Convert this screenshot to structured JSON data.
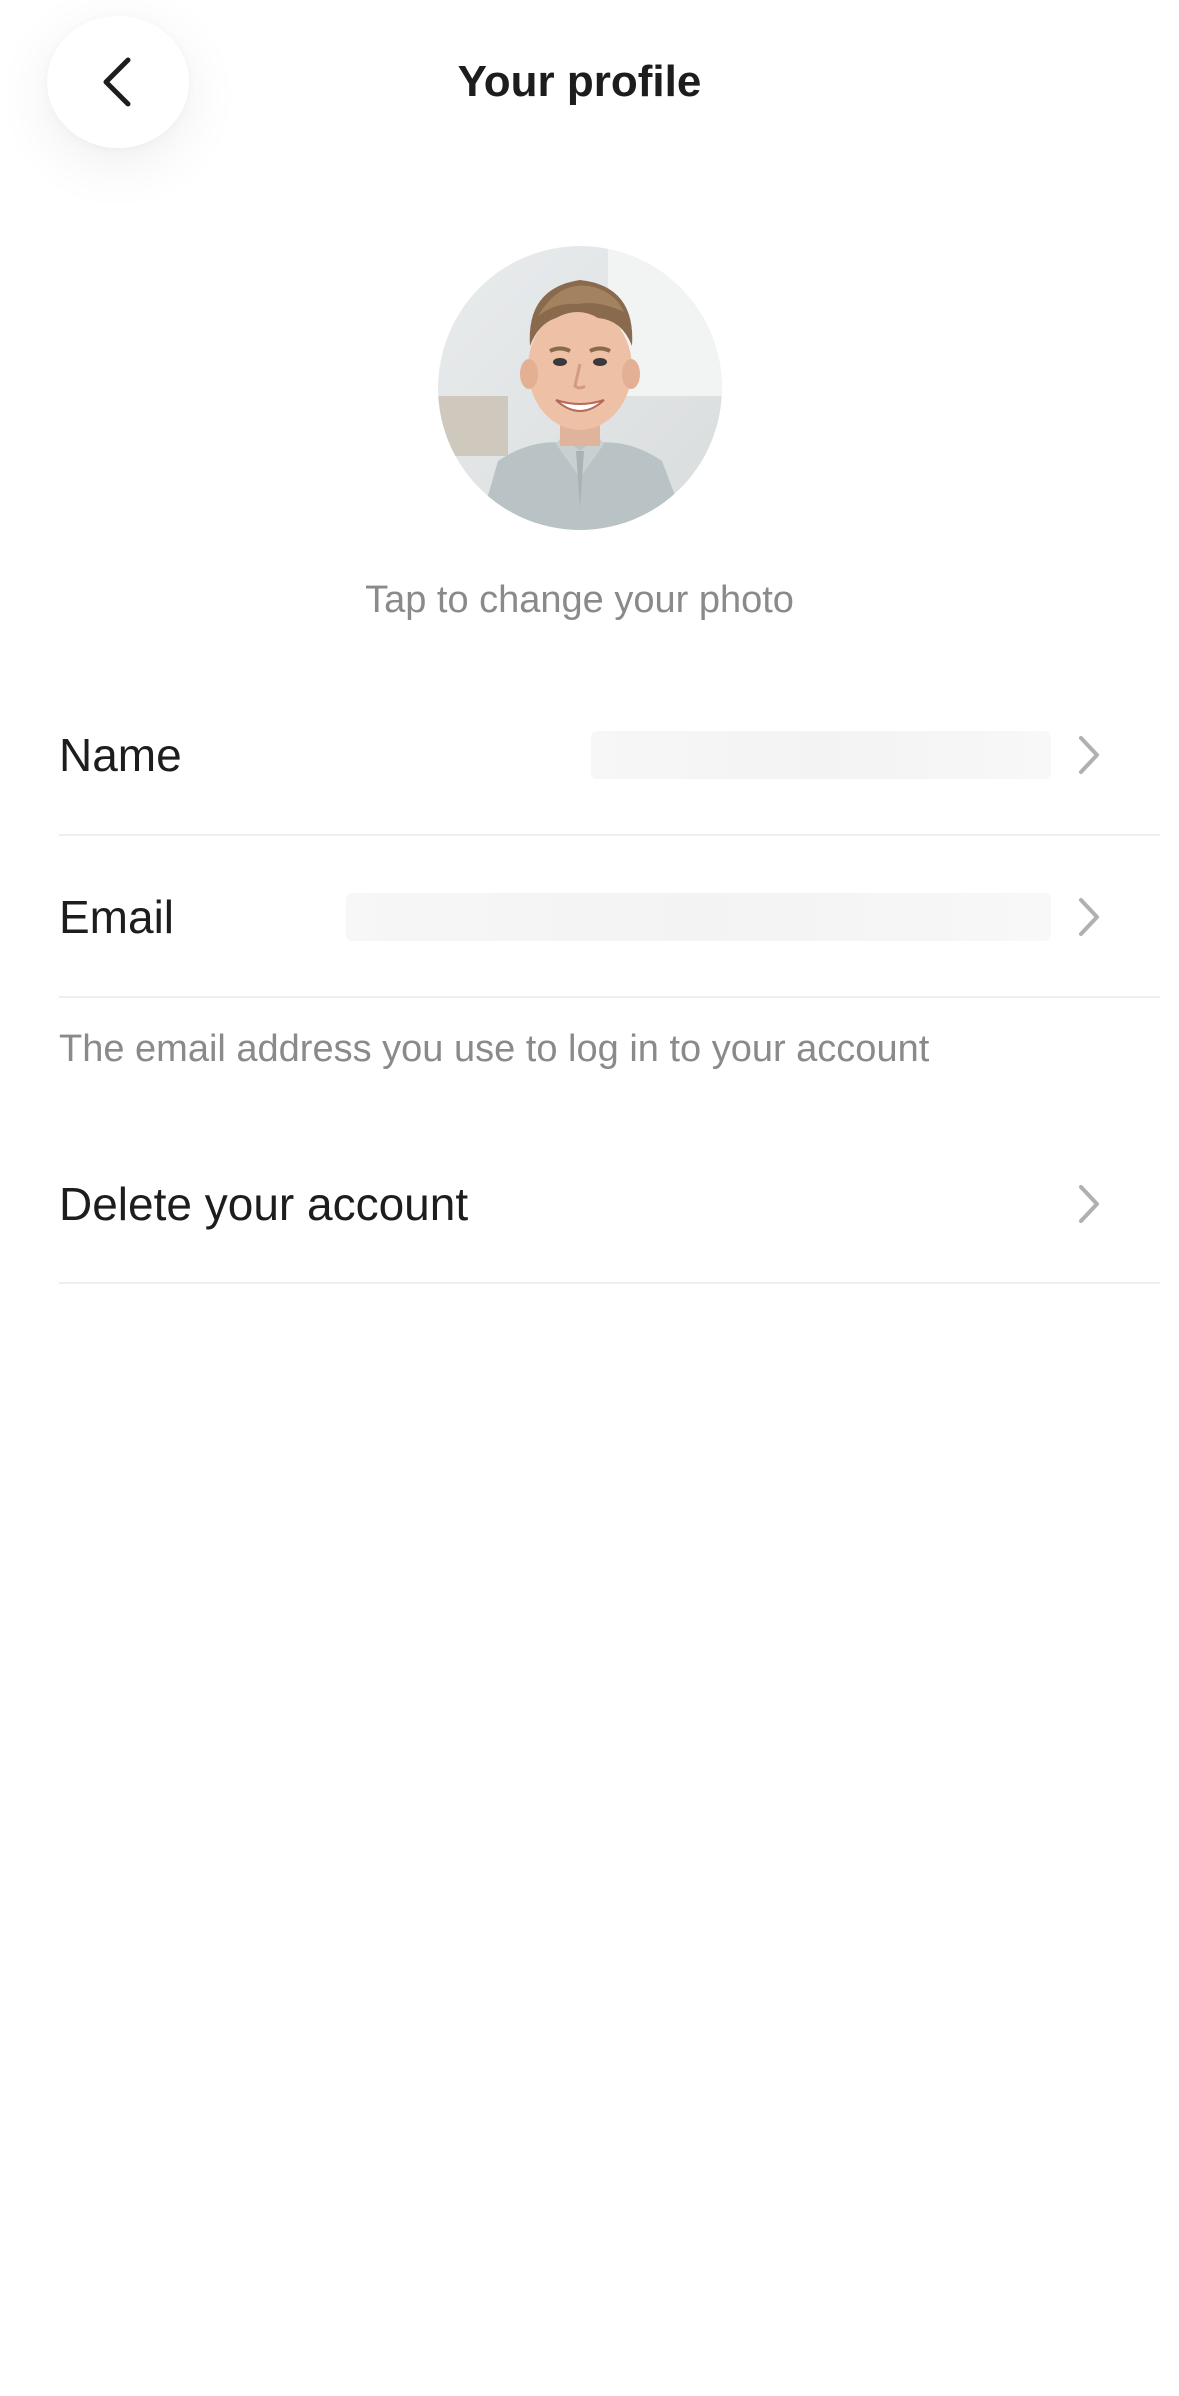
{
  "header": {
    "title": "Your profile",
    "back_icon": "chevron-left-icon"
  },
  "profile": {
    "photo_caption": "Tap to change your photo"
  },
  "rows": {
    "name": {
      "label": "Name",
      "value": ""
    },
    "email": {
      "label": "Email",
      "value": ""
    },
    "email_helper": "The email address you use to log in to your account",
    "delete": {
      "label": "Delete your account"
    }
  },
  "colors": {
    "text_primary": "#1d1d1d",
    "text_secondary": "#8a8a8a",
    "divider": "#eeeeee",
    "chevron": "#b0b0b0",
    "redacted_field": "#f5f5f5"
  }
}
